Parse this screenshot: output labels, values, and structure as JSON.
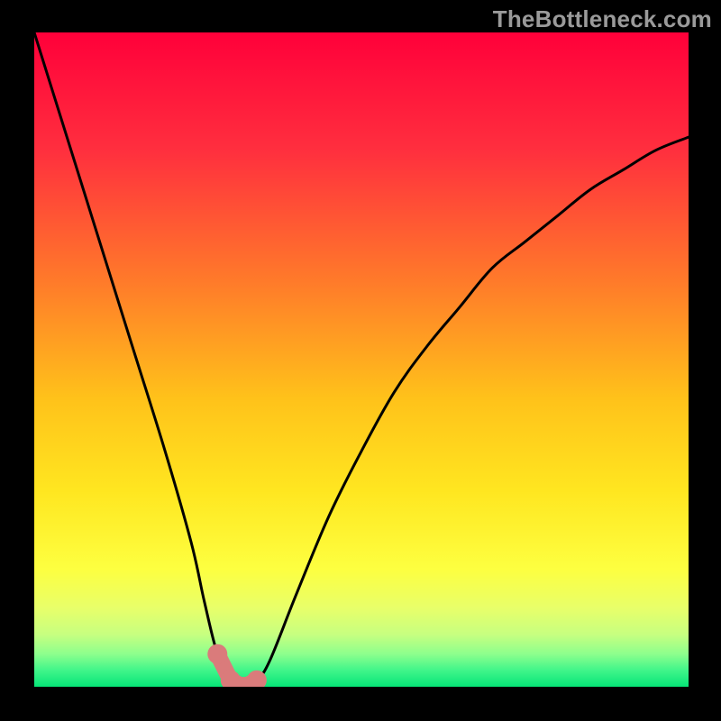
{
  "watermark": "TheBottleneck.com",
  "chart_data": {
    "type": "line",
    "title": "",
    "xlabel": "",
    "ylabel": "",
    "xlim": [
      0,
      100
    ],
    "ylim": [
      0,
      100
    ],
    "optimum_x_range": [
      28,
      35
    ],
    "series": [
      {
        "name": "bottleneck-curve",
        "x": [
          0,
          5,
          10,
          15,
          20,
          24,
          26,
          28,
          30,
          32,
          34,
          36,
          40,
          45,
          50,
          55,
          60,
          65,
          70,
          75,
          80,
          85,
          90,
          95,
          100
        ],
        "y": [
          100,
          84,
          68,
          52,
          36,
          22,
          13,
          5,
          1,
          0,
          1,
          4,
          14,
          26,
          36,
          45,
          52,
          58,
          64,
          68,
          72,
          76,
          79,
          82,
          84
        ]
      }
    ],
    "markers": [
      {
        "name": "ideal-zone",
        "x": [
          28,
          30,
          32,
          34
        ],
        "y": [
          5,
          1,
          0,
          1
        ]
      }
    ],
    "background_gradient": {
      "type": "vertical",
      "stops": [
        {
          "pos": 0.0,
          "color": "#ff003a"
        },
        {
          "pos": 0.18,
          "color": "#ff2f3e"
        },
        {
          "pos": 0.38,
          "color": "#ff7a2a"
        },
        {
          "pos": 0.56,
          "color": "#ffc21a"
        },
        {
          "pos": 0.7,
          "color": "#ffe620"
        },
        {
          "pos": 0.82,
          "color": "#fdff40"
        },
        {
          "pos": 0.88,
          "color": "#e8ff6a"
        },
        {
          "pos": 0.92,
          "color": "#c7ff80"
        },
        {
          "pos": 0.95,
          "color": "#8dff8d"
        },
        {
          "pos": 0.975,
          "color": "#40f58a"
        },
        {
          "pos": 1.0,
          "color": "#06e577"
        }
      ]
    }
  }
}
